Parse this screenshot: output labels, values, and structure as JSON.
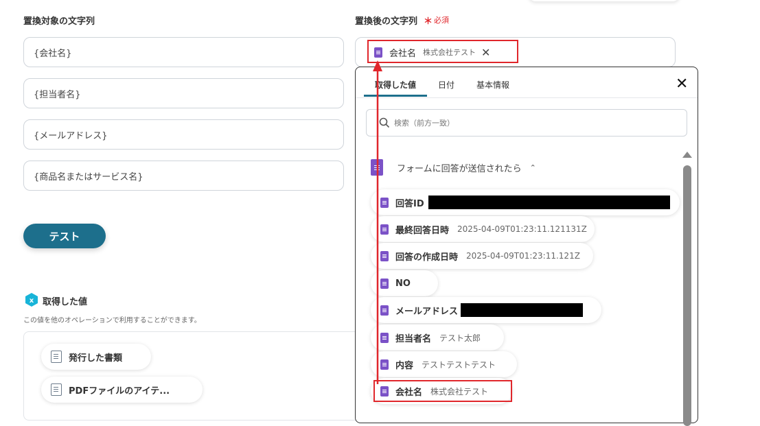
{
  "left_form": {
    "target_label": "置換対象の文字列",
    "fields": [
      {
        "value": "{会社名}"
      },
      {
        "value": "{担当者名}"
      },
      {
        "value": "{メールアドレス}"
      },
      {
        "value": "{商品名またはサービス名}"
      }
    ],
    "test_button": "テスト"
  },
  "right_form": {
    "replacement_label": "置換後の文字列",
    "required_mark": "＊",
    "required_text": "必須",
    "token": {
      "name": "会社名",
      "value": "株式会社テスト"
    }
  },
  "acquired": {
    "title": "取得した値",
    "description": "この値を他のオペレーションで利用することができます。",
    "items": [
      {
        "label": "発行した書類"
      },
      {
        "label": "PDFファイルのアイテ..."
      }
    ]
  },
  "popup": {
    "tabs": [
      "取得した値",
      "日付",
      "基本情報"
    ],
    "search_placeholder": "検索（前方一致）",
    "section_title": "フォームに回答が送信されたら",
    "items": [
      {
        "name": "回答ID",
        "value": ""
      },
      {
        "name": "最終回答日時",
        "value": "2025-04-09T01:23:11.121131Z"
      },
      {
        "name": "回答の作成日時",
        "value": "2025-04-09T01:23:11.121Z"
      },
      {
        "name": "NO",
        "value": ""
      },
      {
        "name": "メールアドレス",
        "value": ""
      },
      {
        "name": "担当者名",
        "value": "テスト太郎"
      },
      {
        "name": "内容",
        "value": "テストテストテスト"
      },
      {
        "name": "会社名",
        "value": "株式会社テスト"
      }
    ]
  },
  "colors": {
    "accent": "#1d6f8c",
    "highlight": "#e0262b",
    "sheet_icon": "#7b52c7"
  }
}
